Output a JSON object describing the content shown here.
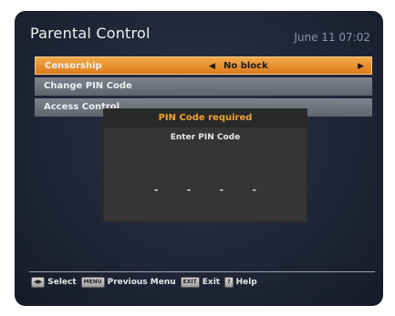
{
  "header": {
    "title": "Parental Control",
    "datetime": "June 11 07:02"
  },
  "menu": {
    "censorship": {
      "label": "Censorship",
      "value": "No block",
      "left_arrow": "◀",
      "right_arrow": "▶"
    },
    "change_pin": {
      "label": "Change PIN Code"
    },
    "access_control": {
      "label": "Access Control"
    }
  },
  "pin_dialog": {
    "title": "PIN Code required",
    "prompt": "Enter PIN Code",
    "digits": [
      "-",
      "-",
      "-",
      "-"
    ]
  },
  "footer": {
    "select": {
      "key": "◀▶",
      "label": "Select"
    },
    "menu": {
      "key": "MENU",
      "label": "Previous Menu"
    },
    "exit": {
      "key": "EXIT",
      "label": "Exit"
    },
    "help": {
      "key": "?",
      "label": "Help"
    }
  },
  "colors": {
    "highlight": "#e38a2b",
    "dialog_title": "#f0a338",
    "row": "#6e727d",
    "background": "#1f2536"
  }
}
